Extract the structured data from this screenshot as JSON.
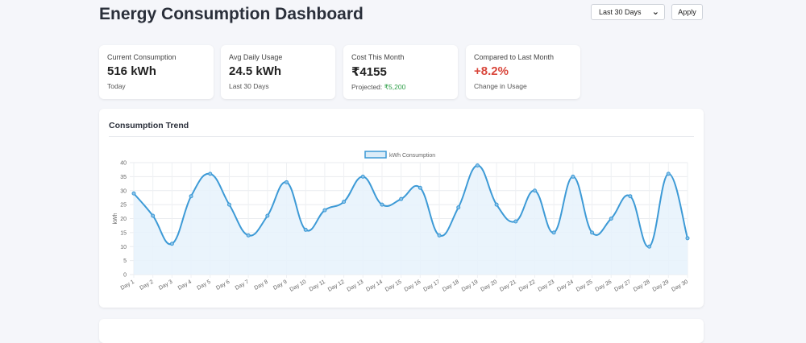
{
  "header": {
    "title": "Energy Consumption Dashboard",
    "range_selected": "Last 30 Days",
    "apply_label": "Apply"
  },
  "stats": [
    {
      "label": "Current Consumption",
      "value": "516 kWh",
      "sub": "Today"
    },
    {
      "label": "Avg Daily Usage",
      "value": "24.5 kWh",
      "sub": "Last 30 Days"
    },
    {
      "label": "Cost This Month",
      "value": "₹4155",
      "sub_prefix": "Projected: ",
      "sub_value": "₹5,200"
    },
    {
      "label": "Compared to Last Month",
      "value": "+8.2%",
      "sub": "Change in Usage"
    }
  ],
  "colors": {
    "line": "#3d9ad6",
    "fill": "#e6f2fb",
    "negative": "#d9463b",
    "positive": "#2a9d45"
  },
  "icons": {
    "dropdown": "chevron-down-icon"
  },
  "chart_section_title": "Consumption Trend",
  "chart_data": {
    "type": "line",
    "categories": [
      "Day 1",
      "Day 2",
      "Day 3",
      "Day 4",
      "Day 5",
      "Day 6",
      "Day 7",
      "Day 8",
      "Day 9",
      "Day 10",
      "Day 11",
      "Day 12",
      "Day 13",
      "Day 14",
      "Day 15",
      "Day 16",
      "Day 17",
      "Day 18",
      "Day 19",
      "Day 20",
      "Day 21",
      "Day 22",
      "Day 23",
      "Day 24",
      "Day 25",
      "Day 26",
      "Day 27",
      "Day 28",
      "Day 29",
      "Day 30"
    ],
    "series": [
      {
        "name": "kWh Consumption",
        "values": [
          29,
          21,
          11,
          28,
          36,
          25,
          14,
          21,
          33,
          16,
          23,
          26,
          35,
          25,
          27,
          31,
          14,
          24,
          39,
          25,
          19,
          30,
          15,
          35,
          15,
          20,
          28,
          10,
          36,
          13
        ]
      }
    ],
    "ylabel": "kWh",
    "xlabel": "",
    "ylim": [
      0,
      40
    ],
    "yticks": [
      0,
      5,
      10,
      15,
      20,
      25,
      30,
      35,
      40
    ],
    "grid": true,
    "legend": "top-center",
    "fill": true,
    "smooth": true
  }
}
